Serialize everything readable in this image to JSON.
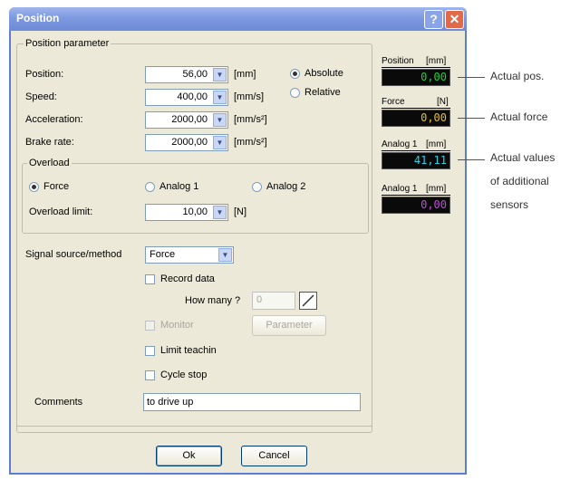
{
  "window": {
    "title": "Position",
    "help_glyph": "?",
    "close_glyph": "✕"
  },
  "position_parameter": {
    "label": "Position parameter",
    "rows": [
      {
        "label": "Position:",
        "value": "56,00",
        "unit": "[mm]"
      },
      {
        "label": "Speed:",
        "value": "400,00",
        "unit": "[mm/s]"
      },
      {
        "label": "Acceleration:",
        "value": "2000,00",
        "unit": "[mm/s²]"
      },
      {
        "label": "Brake rate:",
        "value": "2000,00",
        "unit": "[mm/s²]"
      }
    ],
    "mode_absolute": "Absolute",
    "mode_relative": "Relative",
    "mode_selected": "Absolute"
  },
  "overload": {
    "label": "Overload",
    "options": [
      "Force",
      "Analog 1",
      "Analog 2"
    ],
    "selected": "Force",
    "limit_label": "Overload limit:",
    "limit_value": "10,00",
    "limit_unit": "[N]"
  },
  "signal": {
    "label": "Signal source/method",
    "value": "Force"
  },
  "record_data": {
    "label": "Record data",
    "checked": false
  },
  "how_many": {
    "label": "How many ?",
    "value": "0"
  },
  "monitor": {
    "label": "Monitor",
    "checked": false,
    "disabled": true
  },
  "parameter_button": {
    "label": "Parameter"
  },
  "limit_teachin": {
    "label": "Limit teachin",
    "checked": false
  },
  "cycle_stop": {
    "label": "Cycle stop",
    "checked": false
  },
  "comments": {
    "label": "Comments",
    "value": "to drive up"
  },
  "buttons": {
    "ok": "Ok",
    "cancel": "Cancel"
  },
  "displays": [
    {
      "label": "Position",
      "unit": "[mm]",
      "value": "0,00",
      "color": "#1fd23a"
    },
    {
      "label": "Force",
      "unit": "[N]",
      "value": "0,00",
      "color": "#e8c21a"
    },
    {
      "label": "Analog 1",
      "unit": "[mm]",
      "value": "41,11",
      "color": "#2fd0e6"
    },
    {
      "label": "Analog 1",
      "unit": "[mm]",
      "value": "0,00",
      "color": "#c24ae0"
    }
  ],
  "callouts": {
    "actual_pos": "Actual pos.",
    "actual_force": "Actual force",
    "actual_values_1": "Actual values",
    "actual_values_2": "of additional",
    "actual_values_3": "sensors"
  },
  "colors": {
    "title_bar": "#7d99e0",
    "dialog_bg": "#ece9d8",
    "close_button": "#e06a4a"
  }
}
